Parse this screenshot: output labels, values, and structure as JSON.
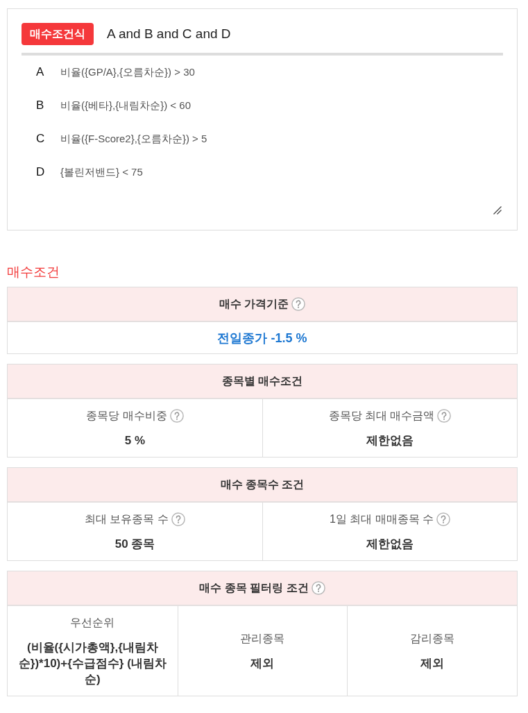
{
  "formula": {
    "badge": "매수조건식",
    "expression": "A and B and C and D",
    "conditions": [
      {
        "letter": "A",
        "text": "비율({GP/A},{오름차순}) > 30"
      },
      {
        "letter": "B",
        "text": "비율({베타},{내림차순}) < 60"
      },
      {
        "letter": "C",
        "text": "비율({F-Score2},{오름차순}) > 5"
      },
      {
        "letter": "D",
        "text": "{볼린저밴드} < 75"
      }
    ]
  },
  "section_title": "매수조건",
  "tables": [
    {
      "kind": "single",
      "title": "매수 가격기준",
      "help_icon": true,
      "cells": [
        {
          "value": "전일종가 -1.5 %"
        }
      ]
    },
    {
      "kind": "grid",
      "title": "종목별 매수조건",
      "help_icon": false,
      "cells": [
        {
          "label": "종목당 매수비중",
          "help_icon": true,
          "value": "5 %"
        },
        {
          "label": "종목당 최대 매수금액",
          "help_icon": true,
          "value": "제한없음"
        }
      ]
    },
    {
      "kind": "grid",
      "title": "매수 종목수 조건",
      "help_icon": false,
      "cells": [
        {
          "label": "최대 보유종목 수",
          "help_icon": true,
          "value": "50 종목"
        },
        {
          "label": "1일 최대 매매종목 수",
          "help_icon": true,
          "value": "제한없음"
        }
      ]
    },
    {
      "kind": "grid",
      "title": "매수 종목 필터링 조건",
      "help_icon": true,
      "cells": [
        {
          "label": "우선순위",
          "help_icon": false,
          "value": "(비율({시가총액},{내림차순})*10)+{수급점수} (내림차순)"
        },
        {
          "label": "관리종목",
          "help_icon": false,
          "value": "제외"
        },
        {
          "label": "감리종목",
          "help_icon": false,
          "value": "제외"
        }
      ]
    }
  ]
}
